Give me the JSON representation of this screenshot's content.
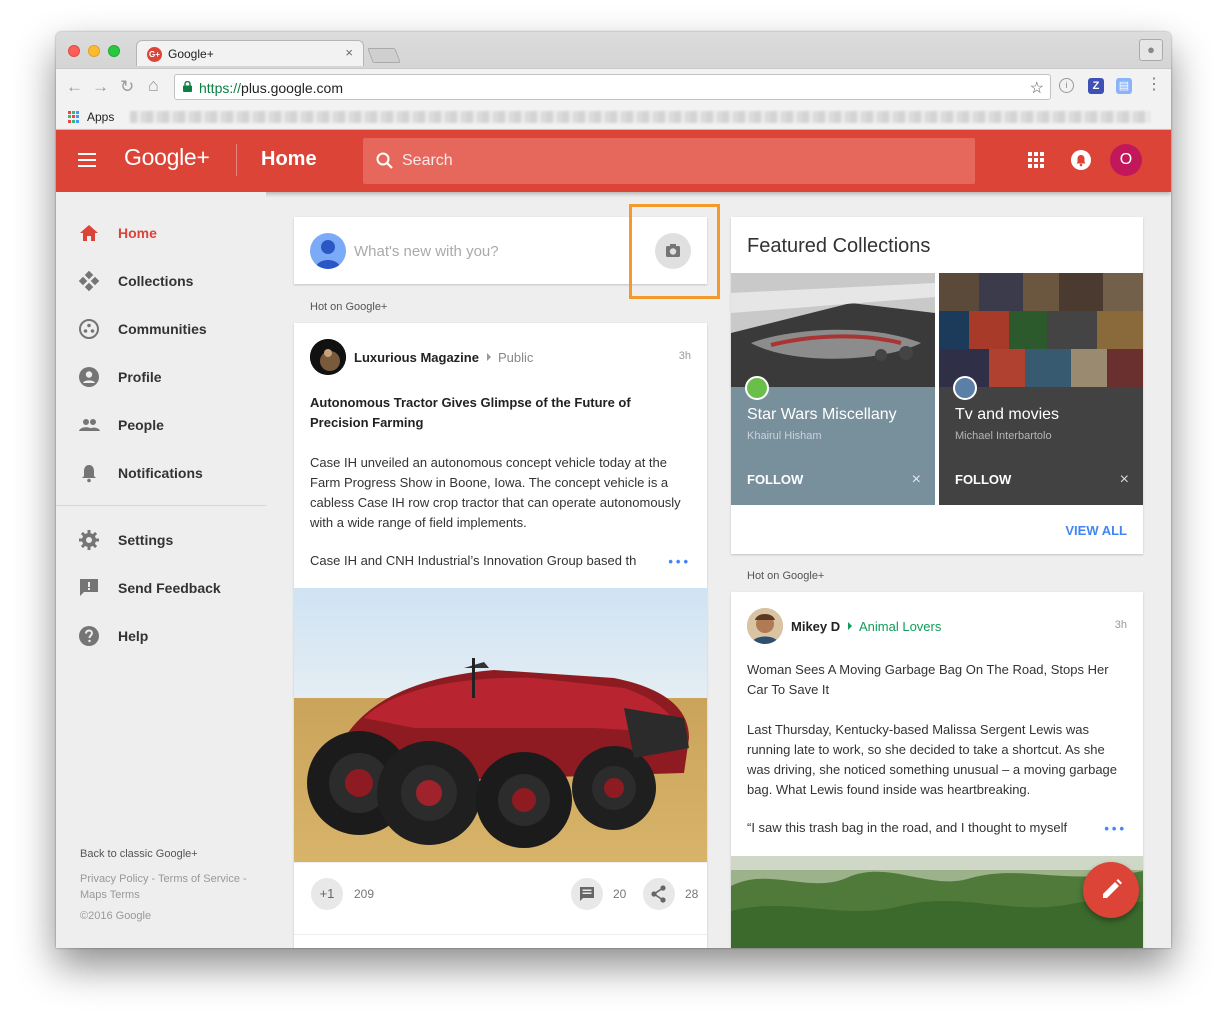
{
  "browser": {
    "tab_title": "Google+",
    "tab_close": "×",
    "url_scheme": "https://",
    "url_host": "plus.google.com",
    "bookmark_apps": "Apps",
    "ext_z": "Z"
  },
  "header": {
    "logo": "Google+",
    "page_title": "Home",
    "search_placeholder": "Search",
    "avatar_initial": "O",
    "brand_color": "#db4437"
  },
  "sidebar": {
    "items": [
      {
        "label": "Home",
        "icon": "home-icon"
      },
      {
        "label": "Collections",
        "icon": "collections-icon"
      },
      {
        "label": "Communities",
        "icon": "communities-icon"
      },
      {
        "label": "Profile",
        "icon": "profile-icon"
      },
      {
        "label": "People",
        "icon": "people-icon"
      },
      {
        "label": "Notifications",
        "icon": "bell-icon"
      },
      {
        "label": "Settings",
        "icon": "gear-icon"
      },
      {
        "label": "Send Feedback",
        "icon": "feedback-icon"
      },
      {
        "label": "Help",
        "icon": "help-icon"
      }
    ],
    "back_classic": "Back to classic Google+",
    "legal": "Privacy Policy - Terms of Service - Maps Terms",
    "copyright": "©2016 Google"
  },
  "compose": {
    "placeholder": "What's new with you?"
  },
  "feed": {
    "hot_label": "Hot on Google+",
    "post1": {
      "author": "Luxurious Magazine",
      "visibility": "Public",
      "time": "3h",
      "title": "Autonomous Tractor Gives Glimpse of the Future of Precision Farming",
      "body": "Case IH unveiled an autonomous concept vehicle today at the Farm Progress Show in Boone, Iowa. The concept vehicle is a cabless Case IH row crop tractor that can operate autonomously with a wide range of field implements.",
      "more": "Case IH and CNH Industrial’s Innovation Group based th",
      "plus_label": "+1",
      "plus_count": "209",
      "comment_count": "20",
      "share_count": "28"
    },
    "post2": {
      "author": "Mikey D",
      "community": "Animal Lovers",
      "time": "3h",
      "title": "Woman Sees A Moving Garbage Bag On The Road, Stops Her Car To Save It",
      "body": "Last Thursday, Kentucky-based Malissa Sergent Lewis was running late to work, so she decided to take a shortcut. As she was driving, she noticed something unusual – a moving garbage bag. What Lewis found inside was heartbreaking.",
      "more": "“I saw this trash bag in the road, and I thought to myself"
    }
  },
  "featured": {
    "title": "Featured Collections",
    "collections": [
      {
        "name": "Star Wars Miscellany",
        "owner": "Khairul Hisham",
        "follow": "FOLLOW",
        "color": "#78909c"
      },
      {
        "name": "Tv and movies",
        "owner": "Michael Interbartolo",
        "follow": "FOLLOW",
        "color": "#424242"
      }
    ],
    "dismiss": "×",
    "view_all": "VIEW ALL"
  }
}
